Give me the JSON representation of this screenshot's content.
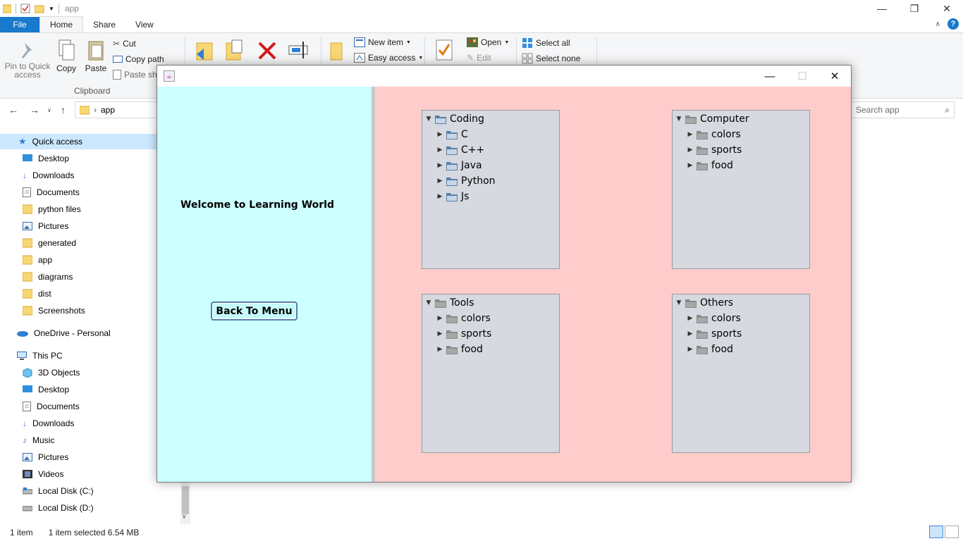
{
  "explorer": {
    "title": "app",
    "tabs": [
      {
        "label": "File"
      },
      {
        "label": "Home"
      },
      {
        "label": "Share"
      },
      {
        "label": "View"
      }
    ],
    "ribbon": {
      "pin_label_1": "Pin to Quick",
      "pin_label_2": "access",
      "copy": "Copy",
      "paste": "Paste",
      "cut": "Cut",
      "copy_path": "Copy path",
      "paste_shortcut": "Paste sh",
      "clipboard_group": "Clipboard",
      "new_item": "New item",
      "easy_access": "Easy access",
      "open": "Open",
      "edit": "Edit",
      "select_all": "Select all",
      "select_none": "Select none"
    },
    "address": {
      "path": "app"
    },
    "search": {
      "placeholder": "Search app"
    },
    "nav": [
      {
        "label": "Quick access",
        "icon": "star-icon"
      },
      {
        "label": "Desktop",
        "icon": "desktop-icon"
      },
      {
        "label": "Downloads",
        "icon": "download-icon"
      },
      {
        "label": "Documents",
        "icon": "document-icon"
      },
      {
        "label": "python files",
        "icon": "folder-icon"
      },
      {
        "label": "Pictures",
        "icon": "pictures-icon"
      },
      {
        "label": "generated",
        "icon": "folder-icon"
      },
      {
        "label": "app",
        "icon": "folder-icon"
      },
      {
        "label": "diagrams",
        "icon": "folder-icon"
      },
      {
        "label": "dist",
        "icon": "folder-icon"
      },
      {
        "label": "Screenshots",
        "icon": "folder-icon"
      },
      {
        "label": "OneDrive - Personal",
        "icon": "cloud-icon"
      },
      {
        "label": "This PC",
        "icon": "computer-icon"
      },
      {
        "label": "3D Objects",
        "icon": "cube-icon"
      },
      {
        "label": "Desktop",
        "icon": "desktop-icon"
      },
      {
        "label": "Documents",
        "icon": "document-icon"
      },
      {
        "label": "Downloads",
        "icon": "download-icon"
      },
      {
        "label": "Music",
        "icon": "music-icon"
      },
      {
        "label": "Pictures",
        "icon": "pictures-icon"
      },
      {
        "label": "Videos",
        "icon": "video-icon"
      },
      {
        "label": "Local Disk (C:)",
        "icon": "disk-icon"
      },
      {
        "label": "Local Disk (D:)",
        "icon": "disk-icon"
      }
    ],
    "status": {
      "count": "1 item",
      "selected": "1 item selected  6.54 MB"
    }
  },
  "app": {
    "welcome": "Welcome to Learning World",
    "back_button": "Back To Menu",
    "trees": [
      {
        "root": "Coding",
        "children": [
          "C",
          "C++",
          "Java",
          "Python",
          "Js"
        ],
        "style": "blue"
      },
      {
        "root": "Computer",
        "children": [
          "colors",
          "sports",
          "food"
        ],
        "style": "gray"
      },
      {
        "root": "Tools",
        "children": [
          "colors",
          "sports",
          "food"
        ],
        "style": "gray"
      },
      {
        "root": "Others",
        "children": [
          "colors",
          "sports",
          "food"
        ],
        "style": "gray"
      }
    ]
  },
  "colors": {
    "left_panel": "#ccffff",
    "right_panel": "#ffcccc",
    "tree_bg": "#d6d9e0",
    "file_tab": "#1979ca"
  }
}
